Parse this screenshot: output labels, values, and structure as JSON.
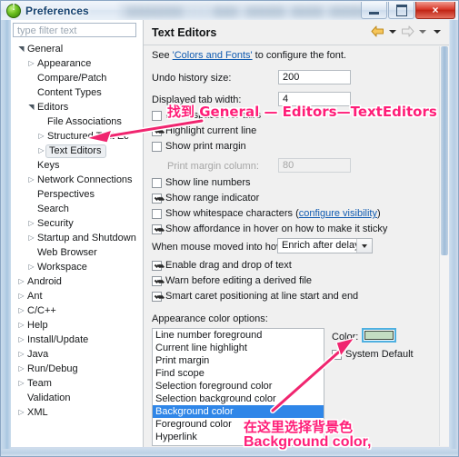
{
  "window": {
    "title": "Preferences",
    "icon": "info-icon",
    "buttons": {
      "minimize": "minimize-icon",
      "maximize": "maximize-icon",
      "close": "×"
    }
  },
  "sidebar": {
    "filter": {
      "placeholder": "type filter text",
      "value": ""
    },
    "items": [
      {
        "label": "General",
        "indent": 0,
        "arrow": "open",
        "selected": false
      },
      {
        "label": "Appearance",
        "indent": 1,
        "arrow": "closed",
        "selected": false
      },
      {
        "label": "Compare/Patch",
        "indent": 1,
        "arrow": "none",
        "selected": false
      },
      {
        "label": "Content Types",
        "indent": 1,
        "arrow": "none",
        "selected": false
      },
      {
        "label": "Editors",
        "indent": 1,
        "arrow": "open",
        "selected": false
      },
      {
        "label": "File Associations",
        "indent": 2,
        "arrow": "none",
        "selected": false
      },
      {
        "label": "Structured Text Ec",
        "indent": 2,
        "arrow": "closed",
        "selected": false
      },
      {
        "label": "Text Editors",
        "indent": 2,
        "arrow": "closed",
        "selected": true
      },
      {
        "label": "Keys",
        "indent": 1,
        "arrow": "none",
        "selected": false
      },
      {
        "label": "Network Connections",
        "indent": 1,
        "arrow": "closed",
        "selected": false
      },
      {
        "label": "Perspectives",
        "indent": 1,
        "arrow": "none",
        "selected": false
      },
      {
        "label": "Search",
        "indent": 1,
        "arrow": "none",
        "selected": false
      },
      {
        "label": "Security",
        "indent": 1,
        "arrow": "closed",
        "selected": false
      },
      {
        "label": "Startup and Shutdown",
        "indent": 1,
        "arrow": "closed",
        "selected": false
      },
      {
        "label": "Web Browser",
        "indent": 1,
        "arrow": "none",
        "selected": false
      },
      {
        "label": "Workspace",
        "indent": 1,
        "arrow": "closed",
        "selected": false
      },
      {
        "label": "Android",
        "indent": 0,
        "arrow": "closed",
        "selected": false
      },
      {
        "label": "Ant",
        "indent": 0,
        "arrow": "closed",
        "selected": false
      },
      {
        "label": "C/C++",
        "indent": 0,
        "arrow": "closed",
        "selected": false
      },
      {
        "label": "Help",
        "indent": 0,
        "arrow": "closed",
        "selected": false
      },
      {
        "label": "Install/Update",
        "indent": 0,
        "arrow": "closed",
        "selected": false
      },
      {
        "label": "Java",
        "indent": 0,
        "arrow": "closed",
        "selected": false
      },
      {
        "label": "Run/Debug",
        "indent": 0,
        "arrow": "closed",
        "selected": false
      },
      {
        "label": "Team",
        "indent": 0,
        "arrow": "closed",
        "selected": false
      },
      {
        "label": "Validation",
        "indent": 0,
        "arrow": "none",
        "selected": false
      },
      {
        "label": "XML",
        "indent": 0,
        "arrow": "closed",
        "selected": false
      }
    ]
  },
  "page": {
    "title": "Text Editors",
    "toolbar": {
      "back": "back-arrow",
      "back_menu": "chevron-down",
      "forward": "forward-arrow",
      "forward_menu": "chevron-down",
      "view_menu": "chevron-down"
    },
    "description_pre": "See ",
    "description_link": "'Colors and Fonts'",
    "description_post": " to configure the font.",
    "fields": [
      {
        "label": "Undo history size:",
        "value": "200",
        "disabled": false
      },
      {
        "label": "Displayed tab width:",
        "value": "4",
        "disabled": false
      }
    ],
    "checkboxes": [
      {
        "label": "Insert spaces for tabs",
        "checked": false,
        "disabled": false
      },
      {
        "label": "Highlight current line",
        "checked": true,
        "disabled": false
      },
      {
        "label": "Show print margin",
        "checked": false,
        "disabled": false
      },
      {
        "label": "Show line numbers",
        "checked": false,
        "disabled": false
      },
      {
        "label": "Show range indicator",
        "checked": true,
        "disabled": false
      },
      {
        "label": "Show whitespace characters",
        "checked": false,
        "disabled": false
      },
      {
        "label": "Show affordance in hover on how to make it sticky",
        "checked": true,
        "disabled": false
      },
      {
        "label": "Enable drag and drop of text",
        "checked": true,
        "disabled": false
      },
      {
        "label": "Warn before editing a derived file",
        "checked": true,
        "disabled": false
      },
      {
        "label": "Smart caret positioning at line start and end",
        "checked": true,
        "disabled": false
      }
    ],
    "print_margin_label": "Print margin column:",
    "print_margin_value": "80",
    "whitespace_link": "configure visibility",
    "hover_label": "When mouse moved into hover:",
    "hover_value": "Enrich after delay",
    "appearance_label": "Appearance color options:",
    "color_list": [
      "Line number foreground",
      "Current line highlight",
      "Print margin",
      "Find scope",
      "Selection foreground color",
      "Selection background color",
      "Background color",
      "Foreground color",
      "Hyperlink"
    ],
    "color_list_selected": "Background color",
    "color_label": "Color:",
    "color_swatch_hex": "#c3ddc2",
    "system_default_label": "System Default",
    "system_default_checked": false
  },
  "annotations": [
    {
      "id": "anno-top",
      "text": "找到 General — Editors—TextEditors",
      "color": "#ff1e78"
    },
    {
      "id": "anno-bottom-1",
      "text": "在这里选择背景色",
      "color": "#ff1e78"
    },
    {
      "id": "anno-bottom-2",
      "text": "Background color,",
      "color": "#ff1e78"
    }
  ]
}
